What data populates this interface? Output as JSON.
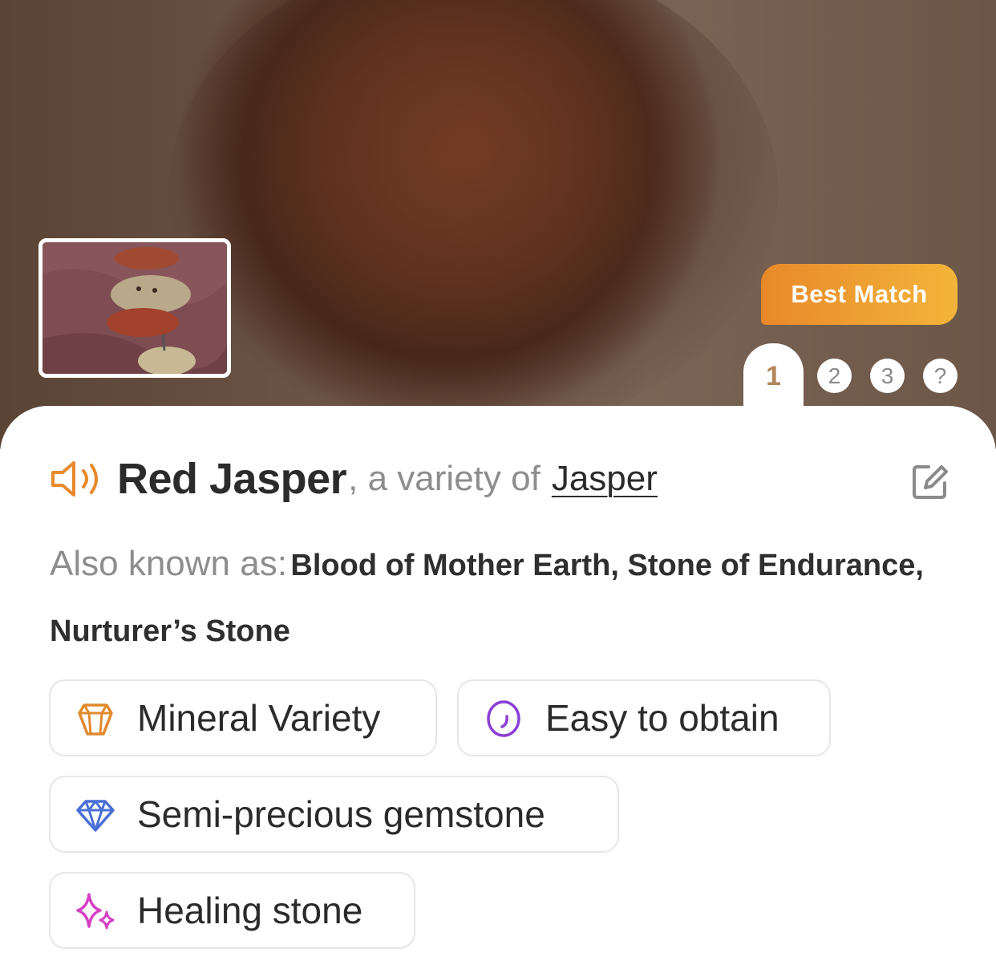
{
  "hero": {
    "best_match_label": "Best Match",
    "result_tabs": [
      "1",
      "2",
      "3",
      "?"
    ],
    "selected_tab": "1"
  },
  "identification": {
    "name": "Red Jasper",
    "variety_text": ", a variety of",
    "parent_link": "Jasper",
    "also_known_label": "Also known as:",
    "also_known_value": "Blood of Mother Earth, Stone of Endurance, Nurturer’s Stone"
  },
  "tags": [
    {
      "label": "Mineral Variety",
      "icon": "crystal-icon",
      "color": "#e08a2e"
    },
    {
      "label": "Easy to obtain",
      "icon": "egg-icon",
      "color": "#8a3fd6"
    },
    {
      "label": "Semi-precious gemstone",
      "icon": "diamond-icon",
      "color": "#4a6fd6"
    },
    {
      "label": "Healing stone",
      "icon": "sparkles-icon",
      "color": "#d63fc4"
    }
  ],
  "colors": {
    "accent_orange": "#e8892a",
    "accent_yellow": "#f3b43a",
    "rank_active": "#b3865a",
    "text_dark": "#2b2b2b",
    "text_muted": "#8d8d8d"
  }
}
